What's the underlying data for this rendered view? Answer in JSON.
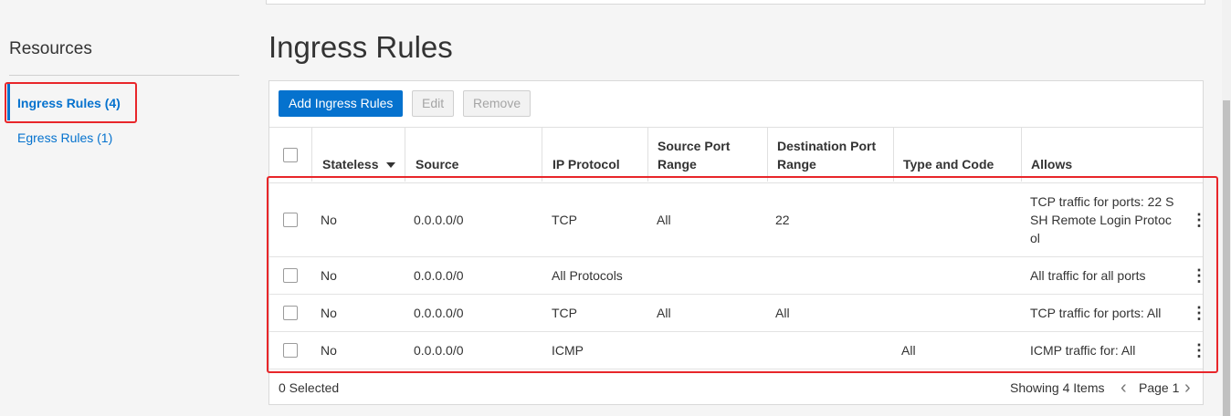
{
  "sidebar": {
    "title": "Resources",
    "items": [
      {
        "label": "Ingress Rules (4)"
      },
      {
        "label": "Egress Rules (1)"
      }
    ]
  },
  "page": {
    "title": "Ingress Rules"
  },
  "toolbar": {
    "add_label": "Add Ingress Rules",
    "edit_label": "Edit",
    "remove_label": "Remove"
  },
  "table": {
    "columns": {
      "stateless": "Stateless",
      "source": "Source",
      "ip_protocol": "IP Protocol",
      "source_port_line1": "Source Port",
      "source_port_line2": "Range",
      "dest_port_line1": "Destination Port",
      "dest_port_line2": "Range",
      "type_code": "Type and Code",
      "allows": "Allows"
    },
    "rows": [
      {
        "stateless": "No",
        "source": "0.0.0.0/0",
        "ip_protocol": "TCP",
        "source_port": "All",
        "dest_port": "22",
        "type_code": "",
        "allows_lines": [
          "TCP traffic for ports: 22 S",
          "SH Remote Login Protoc",
          "ol"
        ]
      },
      {
        "stateless": "No",
        "source": "0.0.0.0/0",
        "ip_protocol": "All Protocols",
        "source_port": "",
        "dest_port": "",
        "type_code": "",
        "allows_lines": [
          "All traffic for all ports"
        ]
      },
      {
        "stateless": "No",
        "source": "0.0.0.0/0",
        "ip_protocol": "TCP",
        "source_port": "All",
        "dest_port": "All",
        "type_code": "",
        "allows_lines": [
          "TCP traffic for ports: All"
        ]
      },
      {
        "stateless": "No",
        "source": "0.0.0.0/0",
        "ip_protocol": "ICMP",
        "source_port": "",
        "dest_port": "",
        "type_code": "All",
        "allows_lines": [
          "ICMP traffic for: All"
        ]
      }
    ],
    "sort_icon": "caret-down-icon",
    "row_menu_icon": "kebab-menu-icon"
  },
  "footer": {
    "selected": "0 Selected",
    "showing": "Showing 4 Items",
    "page": "Page 1",
    "prev_icon": "chevron-left-icon",
    "next_icon": "chevron-right-icon"
  },
  "colors": {
    "accent": "#0572ce",
    "highlight": "#e8262a"
  }
}
